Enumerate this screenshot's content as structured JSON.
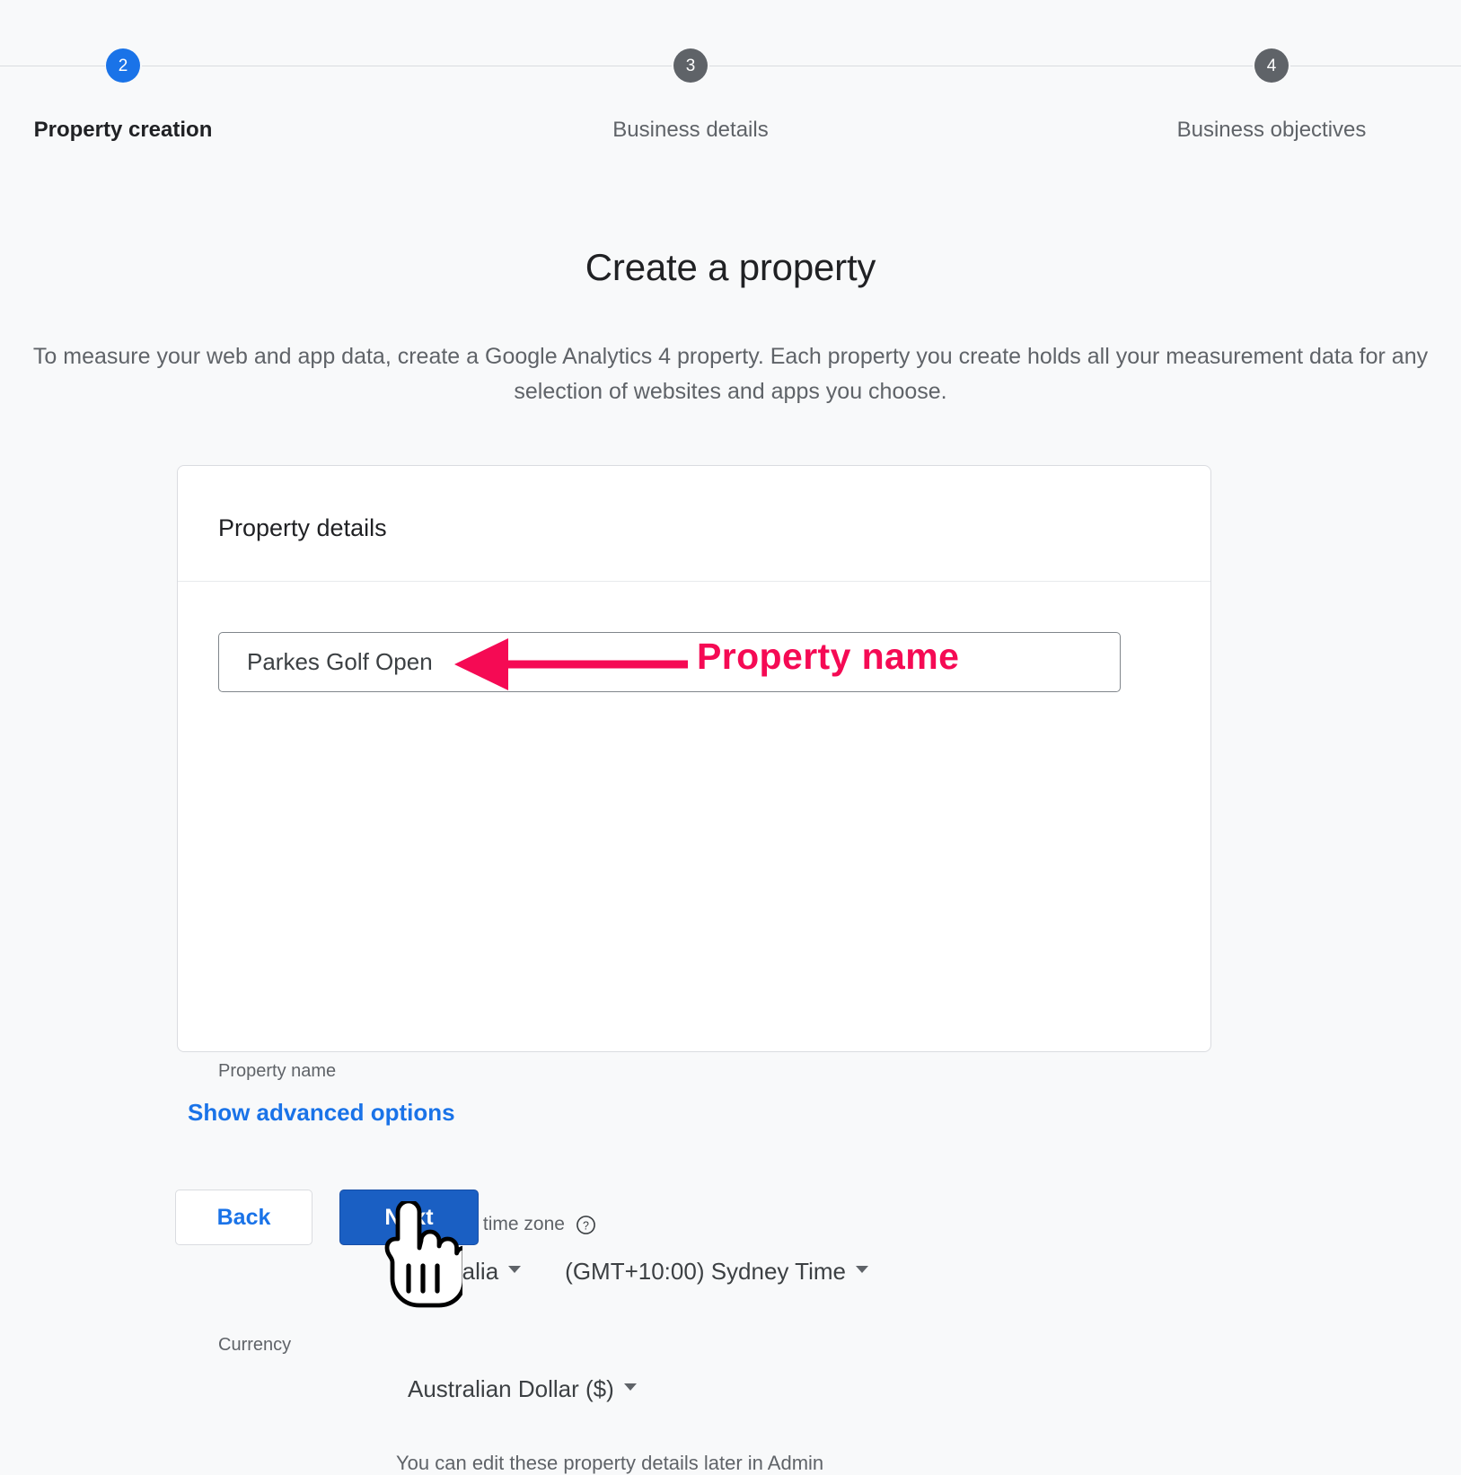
{
  "stepper": {
    "steps": [
      {
        "number": "2",
        "label": "Property creation",
        "state": "active"
      },
      {
        "number": "3",
        "label": "Business details",
        "state": "inactive"
      },
      {
        "number": "4",
        "label": "Business objectives",
        "state": "inactive"
      }
    ],
    "active_color": "#1a73e8",
    "inactive_color": "#5f6368"
  },
  "page": {
    "title": "Create a property",
    "description": "To measure your web and app data, create a Google Analytics 4 property. Each property you create holds all your measurement data for any selection of websites and apps you choose."
  },
  "card": {
    "header_title": "Property details",
    "property_name": {
      "label": "Property name",
      "value": "Parkes Golf Open",
      "placeholder": "Property name"
    },
    "reporting_time_zone": {
      "label": "Reporting time zone",
      "help_icon": "help-circle-icon",
      "country": "Australia",
      "zone": "(GMT+10:00) Sydney Time"
    },
    "currency": {
      "label": "Currency",
      "value": "Australian Dollar ($)"
    },
    "note": "You can edit these property details later in Admin"
  },
  "advanced_link": "Show advanced options",
  "buttons": {
    "back": "Back",
    "next": "Next"
  },
  "annotation": {
    "text": "Property name",
    "color": "#f50a54",
    "arrow": "left-arrow-annotation"
  }
}
